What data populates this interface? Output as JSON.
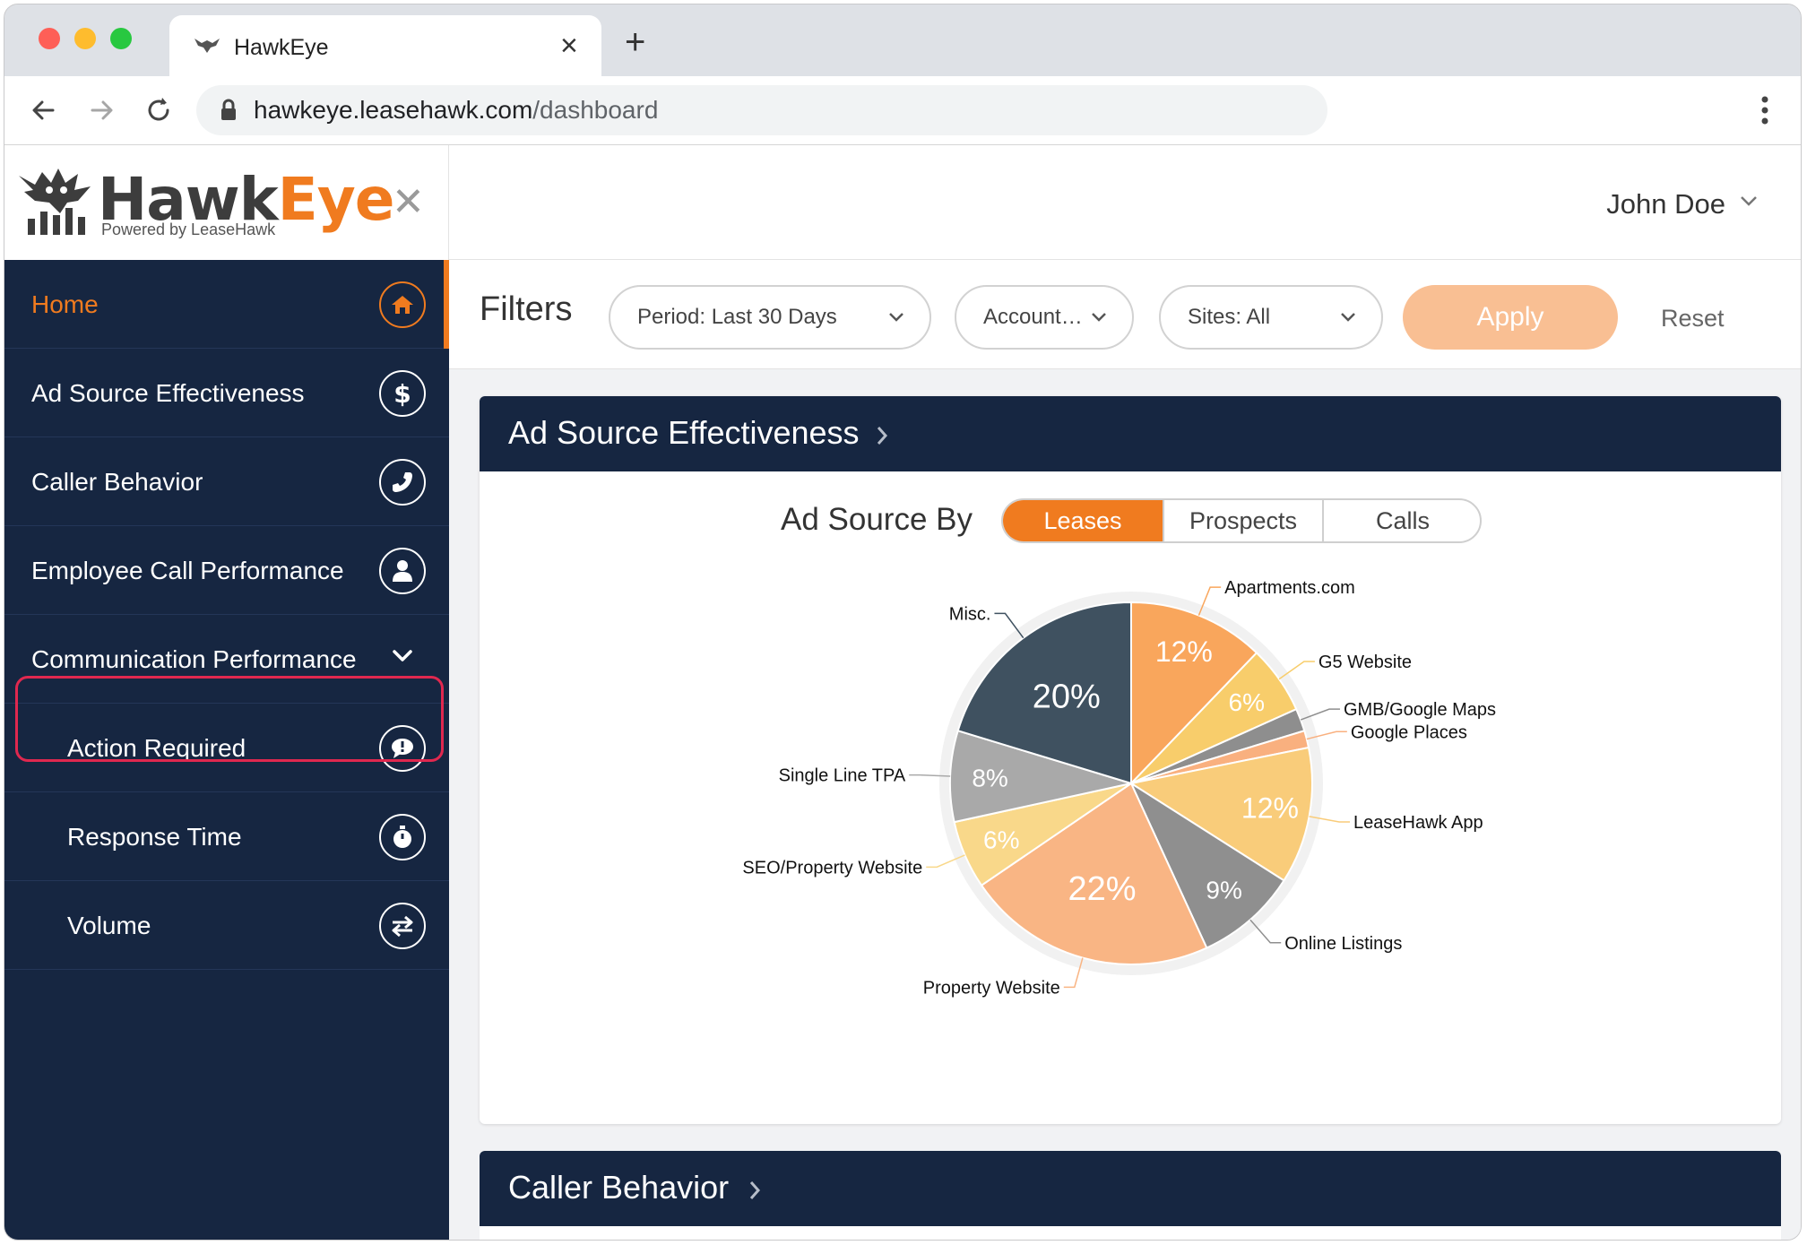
{
  "browser": {
    "tab_title": "HawkEye",
    "url_host": "hawkeye.leasehawk.com",
    "url_path": "/dashboard"
  },
  "logo": {
    "word_a": "Hawk",
    "word_b": "Eye",
    "tagline": "Powered by LeaseHawk"
  },
  "user": {
    "name": "John Doe"
  },
  "sidebar": {
    "items": [
      {
        "label": "Home",
        "icon": "home-icon"
      },
      {
        "label": "Ad Source Effectiveness",
        "icon": "dollar-icon"
      },
      {
        "label": "Caller Behavior",
        "icon": "phone-icon"
      },
      {
        "label": "Employee Call Performance",
        "icon": "user-icon"
      },
      {
        "label": "Communication Performance",
        "icon": "chevron-down-icon"
      },
      {
        "label": "Action Required",
        "icon": "alert-bubble-icon"
      },
      {
        "label": "Response Time",
        "icon": "stopwatch-icon"
      },
      {
        "label": "Volume",
        "icon": "swap-arrows-icon"
      }
    ]
  },
  "filters": {
    "title": "Filters",
    "period": "Period: Last 30 Days",
    "account": "Account…",
    "sites": "Sites: All",
    "apply": "Apply",
    "reset": "Reset"
  },
  "card_ad_source": {
    "title": "Ad Source Effectiveness",
    "by_label": "Ad Source By",
    "toggle": [
      "Leases",
      "Prospects",
      "Calls"
    ],
    "toggle_selected": "Leases"
  },
  "card_caller": {
    "title": "Caller Behavior"
  },
  "colors": {
    "accent": "#f07b1f",
    "navy": "#162641",
    "apply_disabled": "#f9bf93",
    "highlight": "#e0284f"
  },
  "chart_data": {
    "type": "pie",
    "slices": [
      {
        "label": "Apartments.com",
        "value": 12,
        "color": "#f9a65c",
        "text": "12%"
      },
      {
        "label": "G5 Website",
        "value": 6,
        "color": "#f8cd6b",
        "text": "6%"
      },
      {
        "label": "GMB/Google Maps",
        "value": 2,
        "color": "#8e8e8e",
        "text": ""
      },
      {
        "label": "Google Places",
        "value": 1.5,
        "color": "#f9b07f",
        "text": ""
      },
      {
        "label": "LeaseHawk App",
        "value": 12,
        "color": "#f9cc7a",
        "text": "12%"
      },
      {
        "label": "Online Listings",
        "value": 9,
        "color": "#8f8f8f",
        "text": "9%"
      },
      {
        "label": "Property Website",
        "value": 22,
        "color": "#f9b584",
        "text": "22%"
      },
      {
        "label": "SEO/Property Website",
        "value": 6,
        "color": "#f9d88a",
        "text": "6%"
      },
      {
        "label": "Single Line TPA",
        "value": 8,
        "color": "#a9a9a9",
        "text": "8%"
      },
      {
        "label": "Misc.",
        "value": 20,
        "color": "#3f5160",
        "text": "20%"
      }
    ]
  }
}
